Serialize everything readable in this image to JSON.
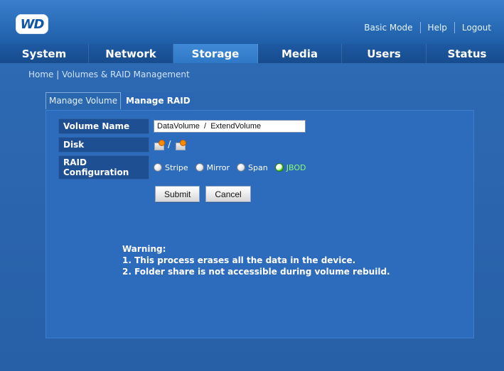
{
  "brand": {
    "logo_text": "WD"
  },
  "top_links": {
    "basic_mode": "Basic Mode",
    "help": "Help",
    "logout": "Logout"
  },
  "nav": {
    "tabs": [
      {
        "label": "System",
        "active": false
      },
      {
        "label": "Network",
        "active": false
      },
      {
        "label": "Storage",
        "active": true
      },
      {
        "label": "Media",
        "active": false
      },
      {
        "label": "Users",
        "active": false
      },
      {
        "label": "Status",
        "active": false
      }
    ]
  },
  "breadcrumb": {
    "home": "Home",
    "separator": "|",
    "current": "Volumes & RAID Management"
  },
  "subtabs": [
    {
      "label": "Manage Volume",
      "active": false
    },
    {
      "label": "Manage RAID",
      "active": true
    }
  ],
  "form": {
    "volume_name_label": "Volume Name",
    "volume_name_value": "DataVolume  /  ExtendVolume",
    "disk_label": "Disk",
    "disk_separator": "/",
    "raid_label_line1": "RAID",
    "raid_label_line2": "Configuration",
    "raid_options": [
      {
        "label": "Stripe",
        "selected": false
      },
      {
        "label": "Mirror",
        "selected": false
      },
      {
        "label": "Span",
        "selected": false
      },
      {
        "label": "JBOD",
        "selected": true
      }
    ],
    "submit_label": "Submit",
    "cancel_label": "Cancel"
  },
  "warning": {
    "title": "Warning:",
    "lines": [
      "1.  This process erases all the data in the device.",
      "2.  Folder share is not accessible during volume rebuild."
    ]
  },
  "icons": {
    "disk_icon": "disk-icon"
  },
  "colors": {
    "primary_blue": "#2a64ac",
    "nav_blue": "#1e59a2",
    "active_tab_blue": "#2f78c5",
    "selected_radio_green": "#3acb00"
  }
}
